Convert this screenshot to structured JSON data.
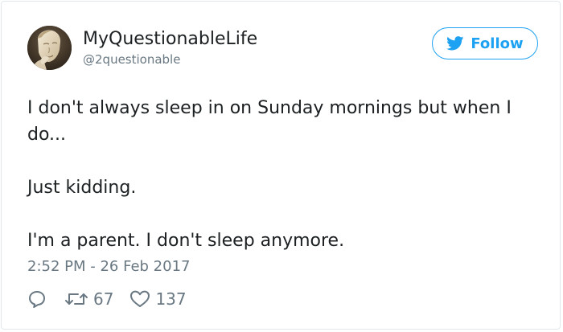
{
  "author": {
    "display_name": "MyQuestionableLife",
    "handle": "@2questionable"
  },
  "follow_button": {
    "label": "Follow"
  },
  "tweet": {
    "paragraphs": [
      "I don't always sleep in on Sunday mornings but when I do...",
      "Just kidding.",
      "I'm a parent. I don't sleep anymore."
    ],
    "timestamp": "2:52 PM - 26 Feb 2017"
  },
  "actions": {
    "retweets": "67",
    "likes": "137"
  },
  "icons": {
    "follow": "twitter-bird-icon",
    "reply": "reply-icon",
    "retweet": "retweet-icon",
    "like": "heart-icon"
  },
  "colors": {
    "accent": "#1da1f2",
    "text": "#1c2022",
    "secondary": "#697882",
    "border": "#e1e8ed"
  }
}
